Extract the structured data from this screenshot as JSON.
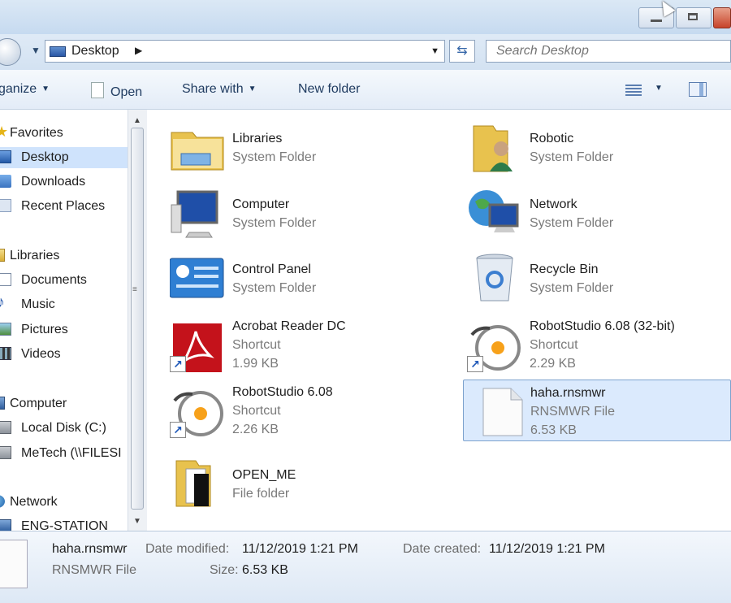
{
  "address": {
    "location": "Desktop"
  },
  "search": {
    "placeholder": "Search Desktop"
  },
  "toolbar": {
    "organize": "ganize",
    "open": "Open",
    "share_with": "Share with",
    "new_folder": "New folder"
  },
  "nav": {
    "favorites": "Favorites",
    "desktop": "Desktop",
    "downloads": "Downloads",
    "recent_places": "Recent Places",
    "libraries": "Libraries",
    "documents": "Documents",
    "music": "Music",
    "pictures": "Pictures",
    "videos": "Videos",
    "computer": "Computer",
    "local_disk": "Local Disk (C:)",
    "metech": "MeTech (\\\\FILESI",
    "network": "Network",
    "eng_station": "ENG-STATION"
  },
  "files": [
    {
      "name": "Libraries",
      "type": "System Folder",
      "size": "",
      "icon": "libraries-icon"
    },
    {
      "name": "Robotic",
      "type": "System Folder",
      "size": "",
      "icon": "user-folder-icon"
    },
    {
      "name": "Computer",
      "type": "System Folder",
      "size": "",
      "icon": "computer-icon"
    },
    {
      "name": "Network",
      "type": "System Folder",
      "size": "",
      "icon": "network-icon"
    },
    {
      "name": "Control Panel",
      "type": "System Folder",
      "size": "",
      "icon": "control-panel-icon"
    },
    {
      "name": "Recycle Bin",
      "type": "System Folder",
      "size": "",
      "icon": "recycle-bin-icon"
    },
    {
      "name": "Acrobat Reader DC",
      "type": "Shortcut",
      "size": "1.99 KB",
      "icon": "acrobat-icon"
    },
    {
      "name": "RobotStudio 6.08 (32-bit)",
      "type": "Shortcut",
      "size": "2.29 KB",
      "icon": "robotstudio-icon"
    },
    {
      "name": "RobotStudio 6.08",
      "type": "Shortcut",
      "size": "2.26 KB",
      "icon": "robotstudio-icon"
    },
    {
      "name": "haha.rnsmwr",
      "type": "RNSMWR File",
      "size": "6.53 KB",
      "icon": "file-icon"
    },
    {
      "name": "OPEN_ME",
      "type": "File folder",
      "size": "",
      "icon": "folder-icon"
    }
  ],
  "details": {
    "name": "haha.rnsmwr",
    "type": "RNSMWR File",
    "date_modified_label": "Date modified:",
    "date_modified": "11/12/2019 1:21 PM",
    "date_created_label": "Date created:",
    "date_created": "11/12/2019 1:21 PM",
    "size_label": "Size:",
    "size": "6.53 KB"
  },
  "colors": {
    "selection": "#dbeafd",
    "toolbar": "#e3ecf7",
    "accent": "#1e3a5f"
  }
}
